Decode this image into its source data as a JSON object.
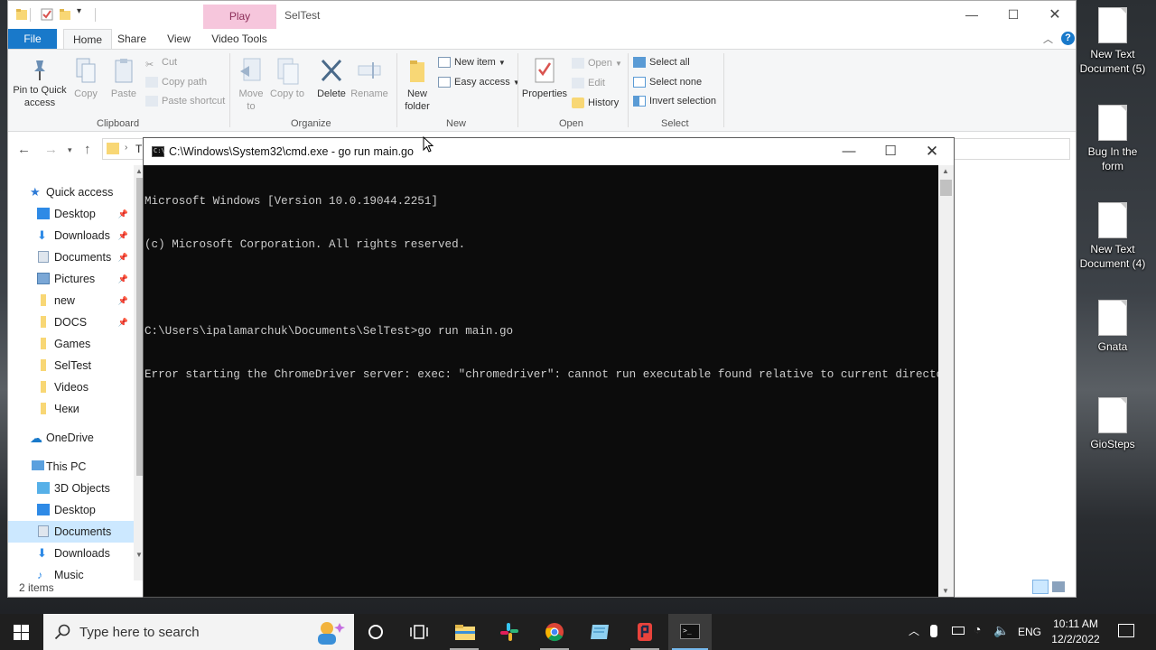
{
  "desktop": {
    "icons": [
      {
        "label": "New Text Document (5)"
      },
      {
        "label": "Bug In the form"
      },
      {
        "label": "New Text Document (4)"
      },
      {
        "label": "Gnata"
      },
      {
        "label": "GioSteps"
      }
    ]
  },
  "explorer": {
    "context_tab": "Play",
    "title": "SelTest",
    "tabs": {
      "file": "File",
      "home": "Home",
      "share": "Share",
      "view": "View",
      "video_tools": "Video Tools"
    },
    "ribbon": {
      "clipboard": {
        "pin": "Pin to Quick access",
        "copy": "Copy",
        "paste": "Paste",
        "cut": "Cut",
        "copy_path": "Copy path",
        "paste_shortcut": "Paste shortcut",
        "group": "Clipboard"
      },
      "organize": {
        "move_to": "Move to",
        "copy_to": "Copy to",
        "delete": "Delete",
        "rename": "Rename",
        "group": "Organize"
      },
      "new": {
        "new_folder": "New folder",
        "new_item": "New item",
        "easy_access": "Easy access",
        "group": "New"
      },
      "open": {
        "properties": "Properties",
        "open": "Open",
        "edit": "Edit",
        "history": "History",
        "group": "Open"
      },
      "select": {
        "select_all": "Select all",
        "select_none": "Select none",
        "invert": "Invert selection",
        "group": "Select"
      }
    },
    "address_partial": "Tl",
    "nav": {
      "quick_access": "Quick access",
      "items": [
        {
          "label": "Desktop",
          "pinned": true
        },
        {
          "label": "Downloads",
          "pinned": true
        },
        {
          "label": "Documents",
          "pinned": true
        },
        {
          "label": "Pictures",
          "pinned": true
        },
        {
          "label": "new",
          "pinned": true
        },
        {
          "label": "DOCS",
          "pinned": true
        },
        {
          "label": "Games",
          "pinned": false
        },
        {
          "label": "SelTest",
          "pinned": false
        },
        {
          "label": "Videos",
          "pinned": false
        },
        {
          "label": "Чеки",
          "pinned": false
        }
      ],
      "onedrive": "OneDrive",
      "this_pc": "This PC",
      "pc_items": [
        {
          "label": "3D Objects"
        },
        {
          "label": "Desktop"
        },
        {
          "label": "Documents",
          "selected": true
        },
        {
          "label": "Downloads"
        },
        {
          "label": "Music"
        }
      ]
    },
    "status": "2 items"
  },
  "cmd": {
    "title": "C:\\Windows\\System32\\cmd.exe - go  run main.go",
    "lines": [
      "Microsoft Windows [Version 10.0.19044.2251]",
      "(c) Microsoft Corporation. All rights reserved.",
      "",
      "C:\\Users\\ipalamarchuk\\Documents\\SelTest>go run main.go",
      "Error starting the ChromeDriver server: exec: \"chromedriver\": cannot run executable found relative to current directory"
    ]
  },
  "taskbar": {
    "search_placeholder": "Type here to search",
    "language": "ENG",
    "time": "10:11 AM",
    "date": "12/2/2022"
  },
  "colors": {
    "accent": "#1979ca",
    "play_tab": "#f6c6dc",
    "console_bg": "#0c0c0c",
    "console_text": "#cccccc",
    "folder": "#f8d775"
  }
}
